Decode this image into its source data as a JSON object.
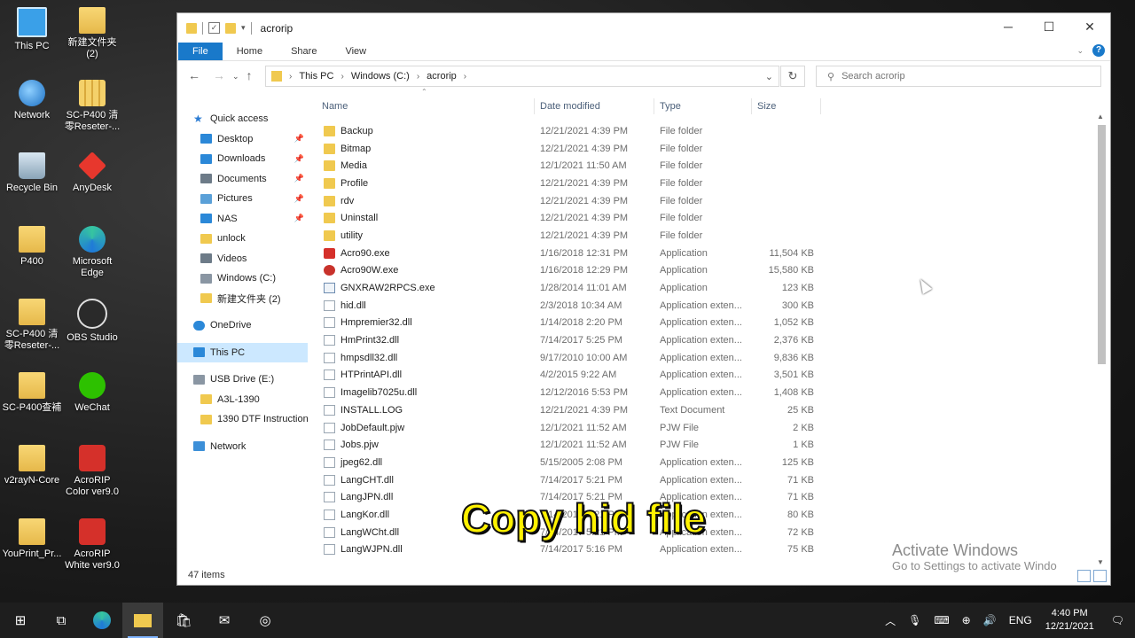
{
  "desktop": {
    "icons": [
      {
        "label": "This PC",
        "icon": "pc-icon"
      },
      {
        "label": "新建文件夹\n(2)",
        "icon": "folder-icon"
      },
      {
        "label": "Network",
        "icon": "network-icon"
      },
      {
        "label": "SC-P400 清\n零Reseter-...",
        "icon": "zip-icon"
      },
      {
        "label": "Recycle Bin",
        "icon": "recycle-bin-icon"
      },
      {
        "label": "AnyDesk",
        "icon": "anydesk-icon"
      },
      {
        "label": "P400",
        "icon": "folder-icon"
      },
      {
        "label": "Microsoft\nEdge",
        "icon": "edge-icon"
      },
      {
        "label": "SC-P400 清\n零Reseter-...",
        "icon": "folder-icon"
      },
      {
        "label": "OBS Studio",
        "icon": "obs-icon"
      },
      {
        "label": "SC-P400查補",
        "icon": "folder-icon"
      },
      {
        "label": "WeChat",
        "icon": "wechat-icon"
      },
      {
        "label": "v2rayN-Core",
        "icon": "folder-icon"
      },
      {
        "label": "AcroRIP\nColor ver9.0",
        "icon": "acrorip-icon"
      },
      {
        "label": "YouPrint_Pr...",
        "icon": "folder-icon"
      },
      {
        "label": "AcroRIP\nWhite ver9.0",
        "icon": "acrorip-icon"
      }
    ]
  },
  "window": {
    "title": "acrorip",
    "ribbon_tabs": [
      "File",
      "Home",
      "Share",
      "View"
    ],
    "breadcrumb": [
      "This PC",
      "Windows (C:)",
      "acrorip"
    ],
    "search_placeholder": "Search acrorip",
    "status_count": "47 items"
  },
  "navpane": {
    "items": [
      {
        "label": "Quick access",
        "icon": "star-icon",
        "pinned": false
      },
      {
        "label": "Desktop",
        "icon": "desktop-icon",
        "pinned": true
      },
      {
        "label": "Downloads",
        "icon": "download-icon",
        "pinned": true
      },
      {
        "label": "Documents",
        "icon": "documents-icon",
        "pinned": true
      },
      {
        "label": "Pictures",
        "icon": "pictures-icon",
        "pinned": true
      },
      {
        "label": "NAS",
        "icon": "nas-icon",
        "pinned": true
      },
      {
        "label": "unlock",
        "icon": "folder-icon",
        "pinned": false
      },
      {
        "label": "Videos",
        "icon": "videos-icon",
        "pinned": false
      },
      {
        "label": "Windows (C:)",
        "icon": "drive-icon",
        "pinned": false
      },
      {
        "label": "新建文件夹 (2)",
        "icon": "folder-icon",
        "pinned": false
      },
      {
        "label": "OneDrive",
        "icon": "onedrive-icon",
        "pinned": false
      },
      {
        "label": "This PC",
        "icon": "pc-icon",
        "pinned": false
      },
      {
        "label": "USB Drive (E:)",
        "icon": "usb-drive-icon",
        "pinned": false
      },
      {
        "label": "A3L-1390",
        "icon": "folder-icon",
        "pinned": false
      },
      {
        "label": "1390 DTF Instruction",
        "icon": "zip-icon",
        "pinned": false
      },
      {
        "label": "Network",
        "icon": "network-icon",
        "pinned": false
      }
    ]
  },
  "columns": {
    "name": "Name",
    "date": "Date modified",
    "type": "Type",
    "size": "Size"
  },
  "files": [
    {
      "name": "Backup",
      "date": "12/21/2021 4:39 PM",
      "type": "File folder",
      "size": "",
      "icon": "folder"
    },
    {
      "name": "Bitmap",
      "date": "12/21/2021 4:39 PM",
      "type": "File folder",
      "size": "",
      "icon": "folder"
    },
    {
      "name": "Media",
      "date": "12/1/2021 11:50 AM",
      "type": "File folder",
      "size": "",
      "icon": "folder"
    },
    {
      "name": "Profile",
      "date": "12/21/2021 4:39 PM",
      "type": "File folder",
      "size": "",
      "icon": "folder"
    },
    {
      "name": "rdv",
      "date": "12/21/2021 4:39 PM",
      "type": "File folder",
      "size": "",
      "icon": "folder"
    },
    {
      "name": "Uninstall",
      "date": "12/21/2021 4:39 PM",
      "type": "File folder",
      "size": "",
      "icon": "folder"
    },
    {
      "name": "utility",
      "date": "12/21/2021 4:39 PM",
      "type": "File folder",
      "size": "",
      "icon": "folder"
    },
    {
      "name": "Acro90.exe",
      "date": "1/16/2018 12:31 PM",
      "type": "Application",
      "size": "11,504 KB",
      "icon": "exe-red"
    },
    {
      "name": "Acro90W.exe",
      "date": "1/16/2018 12:29 PM",
      "type": "Application",
      "size": "15,580 KB",
      "icon": "exe-round"
    },
    {
      "name": "GNXRAW2RPCS.exe",
      "date": "1/28/2014 11:01 AM",
      "type": "Application",
      "size": "123 KB",
      "icon": "exe-win"
    },
    {
      "name": "hid.dll",
      "date": "2/3/2018 10:34 AM",
      "type": "Application exten...",
      "size": "300 KB",
      "icon": "doc"
    },
    {
      "name": "Hmpremier32.dll",
      "date": "1/14/2018 2:20 PM",
      "type": "Application exten...",
      "size": "1,052 KB",
      "icon": "doc"
    },
    {
      "name": "HmPrint32.dll",
      "date": "7/14/2017 5:25 PM",
      "type": "Application exten...",
      "size": "2,376 KB",
      "icon": "doc"
    },
    {
      "name": "hmpsdll32.dll",
      "date": "9/17/2010 10:00 AM",
      "type": "Application exten...",
      "size": "9,836 KB",
      "icon": "doc"
    },
    {
      "name": "HTPrintAPI.dll",
      "date": "4/2/2015 9:22 AM",
      "type": "Application exten...",
      "size": "3,501 KB",
      "icon": "doc"
    },
    {
      "name": "Imagelib7025u.dll",
      "date": "12/12/2016 5:53 PM",
      "type": "Application exten...",
      "size": "1,408 KB",
      "icon": "doc"
    },
    {
      "name": "INSTALL.LOG",
      "date": "12/21/2021 4:39 PM",
      "type": "Text Document",
      "size": "25 KB",
      "icon": "doc"
    },
    {
      "name": "JobDefault.pjw",
      "date": "12/1/2021 11:52 AM",
      "type": "PJW File",
      "size": "2 KB",
      "icon": "doc"
    },
    {
      "name": "Jobs.pjw",
      "date": "12/1/2021 11:52 AM",
      "type": "PJW File",
      "size": "1 KB",
      "icon": "doc"
    },
    {
      "name": "jpeg62.dll",
      "date": "5/15/2005 2:08 PM",
      "type": "Application exten...",
      "size": "125 KB",
      "icon": "doc"
    },
    {
      "name": "LangCHT.dll",
      "date": "7/14/2017 5:21 PM",
      "type": "Application exten...",
      "size": "71 KB",
      "icon": "doc"
    },
    {
      "name": "LangJPN.dll",
      "date": "7/14/2017 5:21 PM",
      "type": "Application exten...",
      "size": "71 KB",
      "icon": "doc"
    },
    {
      "name": "LangKor.dll",
      "date": "7/14/2017 5:21 PM",
      "type": "Application exten...",
      "size": "80 KB",
      "icon": "doc"
    },
    {
      "name": "LangWCht.dll",
      "date": "7/14/2017 5:21 PM",
      "type": "Application exten...",
      "size": "72 KB",
      "icon": "doc"
    },
    {
      "name": "LangWJPN.dll",
      "date": "7/14/2017 5:16 PM",
      "type": "Application exten...",
      "size": "75 KB",
      "icon": "doc"
    }
  ],
  "overlay": {
    "subtitle": "Copy hid file",
    "activate_title": "Activate Windows",
    "activate_sub": "Go to Settings to activate Windo"
  },
  "taskbar": {
    "lang": "ENG",
    "time": "4:40 PM",
    "date": "12/21/2021"
  }
}
